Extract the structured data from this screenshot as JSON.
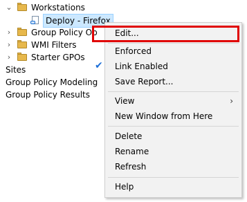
{
  "tree": {
    "items": [
      {
        "label": "Workstations",
        "icon": "folder-icon",
        "expander": "chevron-down-icon"
      },
      {
        "label": "Deploy - Firefox",
        "icon": "gpo-link-icon",
        "selected": true
      },
      {
        "label": "Group Policy Ob",
        "icon": "folder-icon",
        "expander": "chevron-right-icon"
      },
      {
        "label": "WMI Filters",
        "icon": "folder-icon",
        "expander": "chevron-right-icon"
      },
      {
        "label": "Starter GPOs",
        "icon": "folder-icon",
        "expander": "chevron-right-icon"
      },
      {
        "label": "Sites"
      },
      {
        "label": "Group Policy Modeling"
      },
      {
        "label": "Group Policy Results"
      }
    ]
  },
  "context_menu": {
    "items": [
      {
        "label": "Edit..."
      },
      {
        "label": "Enforced"
      },
      {
        "label": "Link Enabled",
        "checked": true
      },
      {
        "label": "Save Report..."
      },
      {
        "label": "View",
        "submenu": true
      },
      {
        "label": "New Window from Here"
      },
      {
        "label": "Delete"
      },
      {
        "label": "Rename"
      },
      {
        "label": "Refresh"
      },
      {
        "label": "Help"
      }
    ],
    "check_glyph": "✔",
    "submenu_glyph": "›"
  },
  "colors": {
    "highlight": "#e00000",
    "selection": "#cce8ff",
    "check": "#1d6fd8"
  }
}
